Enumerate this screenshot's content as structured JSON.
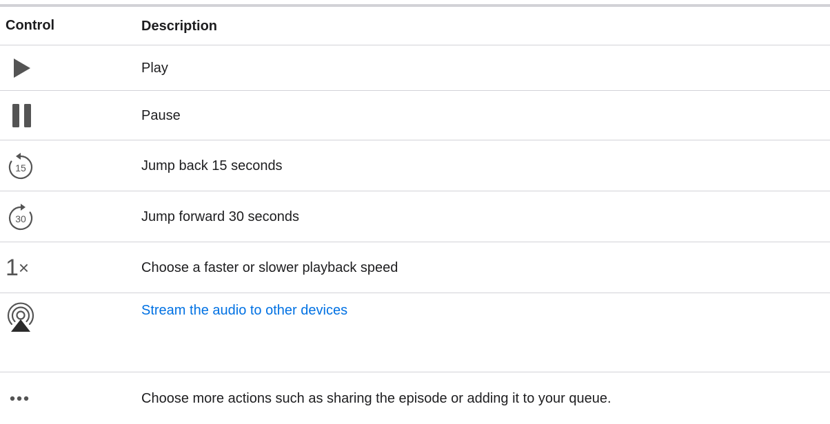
{
  "table": {
    "headers": {
      "control": "Control",
      "description": "Description"
    },
    "rows": [
      {
        "icon": "play-icon",
        "description": "Play"
      },
      {
        "icon": "pause-icon",
        "description": "Pause"
      },
      {
        "icon": "skip-back-15-icon",
        "icon_text": "15",
        "description": "Jump back 15 seconds"
      },
      {
        "icon": "skip-forward-30-icon",
        "icon_text": "30",
        "description": "Jump forward 30 seconds"
      },
      {
        "icon": "playback-speed-icon",
        "icon_text": "1",
        "icon_suffix": "×",
        "description": "Choose a faster or slower playback speed"
      },
      {
        "icon": "airplay-audio-icon",
        "description": "Stream the audio to other devices",
        "is_link": true
      },
      {
        "icon": "more-actions-icon",
        "description": "Choose more actions such as sharing the episode or adding it to your queue."
      }
    ]
  },
  "colors": {
    "icon": "#545454",
    "link": "#0071e3",
    "divider": "#d2d2d7",
    "text": "#1d1d1f"
  }
}
